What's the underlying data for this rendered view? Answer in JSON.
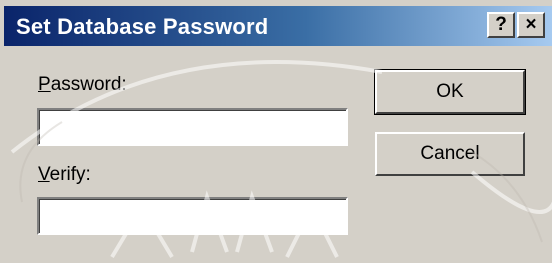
{
  "dialog": {
    "title": "Set Database Password",
    "help_button": "?",
    "close_button": "×"
  },
  "form": {
    "password": {
      "label_mnemonic": "P",
      "label_rest": "assword:",
      "value": ""
    },
    "verify": {
      "label_mnemonic": "V",
      "label_rest": "erify:",
      "value": ""
    }
  },
  "buttons": {
    "ok": "OK",
    "cancel": "Cancel"
  },
  "colors": {
    "face": "#d4d0c8",
    "titlebar_start": "#0a246a",
    "titlebar_end": "#a6caf0"
  }
}
